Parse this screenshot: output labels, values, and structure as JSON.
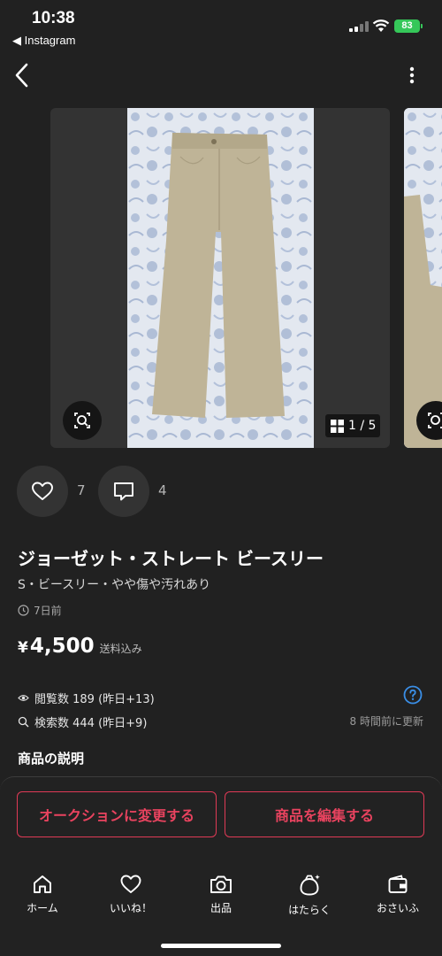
{
  "status_bar": {
    "time": "10:38",
    "back_app": "◀ Instagram",
    "battery": "83"
  },
  "gallery": {
    "counter": "1 / 5"
  },
  "actions": {
    "likes": "7",
    "comments": "4"
  },
  "item": {
    "title": "ジョーゼット・ストレート ビースリー",
    "subtitle": "S・ビースリー・やや傷や汚れあり",
    "posted": "7日前",
    "currency": "¥",
    "price": "4,500",
    "shipping": "送料込み"
  },
  "stats": {
    "views": "閲覧数  189 (昨日+13)",
    "searches": "検索数  444 (昨日+9)",
    "updated": "8 時間前に更新"
  },
  "description_heading": "商品の説明",
  "buttons": {
    "auction": "オークションに変更する",
    "edit": "商品を編集する"
  },
  "tabs": [
    {
      "label": "ホーム",
      "icon": "home-icon"
    },
    {
      "label": "いいね！",
      "icon": "heart-icon"
    },
    {
      "label": "出品",
      "icon": "camera-icon"
    },
    {
      "label": "はたらく",
      "icon": "sparkle-bag-icon"
    },
    {
      "label": "おさいふ",
      "icon": "wallet-icon"
    }
  ],
  "colors": {
    "background": "#212121",
    "accent": "#e03a56",
    "button_bg": "#333333",
    "battery": "#35c759",
    "help": "#3a8ee6"
  }
}
